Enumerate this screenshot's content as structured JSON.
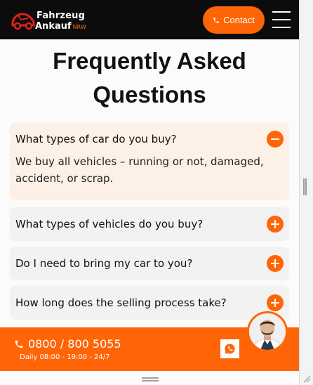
{
  "header": {
    "logo_line1": "Fahrzeug",
    "logo_line2": "Ankauf",
    "logo_tag": "NRW",
    "contact_label": "Contact",
    "icons": {
      "contact": "phone-icon",
      "menu": "hamburger-menu-icon",
      "logo": "car-icon"
    }
  },
  "page": {
    "title_line1": "Frequently Asked",
    "title_line2": "Questions"
  },
  "faq": [
    {
      "question": "What types of car do you buy?",
      "answer": "We buy all vehicles – running or not, damaged, accident, or scrap.",
      "expanded": true
    },
    {
      "question": "What types of vehicles do you buy?",
      "expanded": false
    },
    {
      "question": "Do I need to bring my car to you?",
      "expanded": false
    },
    {
      "question": "How long does the selling process take?",
      "expanded": false
    }
  ],
  "bottom_bar": {
    "phone": "0800 / 800 5055",
    "hours": "Daily 08:00 - 19:00 - 24/7",
    "icons": {
      "phone": "phone-icon",
      "chat": "whatsapp-icon",
      "agent": "avatar"
    }
  },
  "colors": {
    "accent": "#ff6506",
    "header_bg": "#0c0c0c",
    "faq_open_bg": "#fdf0e6",
    "faq_bg": "#f2f2f2"
  }
}
